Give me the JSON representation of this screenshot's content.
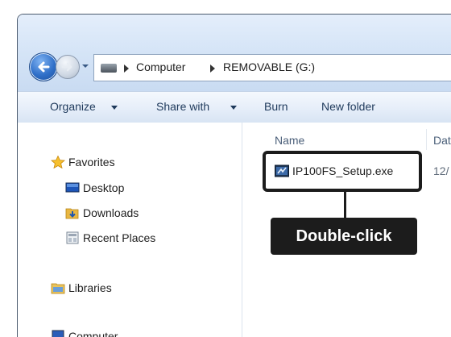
{
  "address_bar": {
    "crumbs": [
      "Computer",
      "REMOVABLE (G:)"
    ]
  },
  "toolbar": {
    "organize_label": "Organize",
    "share_label": "Share with",
    "burn_label": "Burn",
    "new_folder_label": "New folder"
  },
  "nav_pane": {
    "favorites_label": "Favorites",
    "items": [
      "Desktop",
      "Downloads",
      "Recent Places"
    ],
    "libraries_label": "Libraries",
    "computer_label": "Computer"
  },
  "file_list": {
    "columns": [
      "Name",
      "Dat"
    ],
    "files": [
      {
        "name": "IP100FS_Setup.exe",
        "date": "12/"
      }
    ]
  },
  "callout": {
    "label": "Double-click"
  },
  "colors": {
    "titlebar": "#d6e5f7",
    "toolbar_text": "#1e395b",
    "callout": "#1c1c1c"
  },
  "icons": [
    "back-arrow-icon",
    "forward-arrow-icon",
    "drive-icon",
    "star-icon",
    "desktop-icon",
    "downloads-icon",
    "recent-places-icon",
    "libraries-icon",
    "computer-icon",
    "exe-file-icon"
  ]
}
